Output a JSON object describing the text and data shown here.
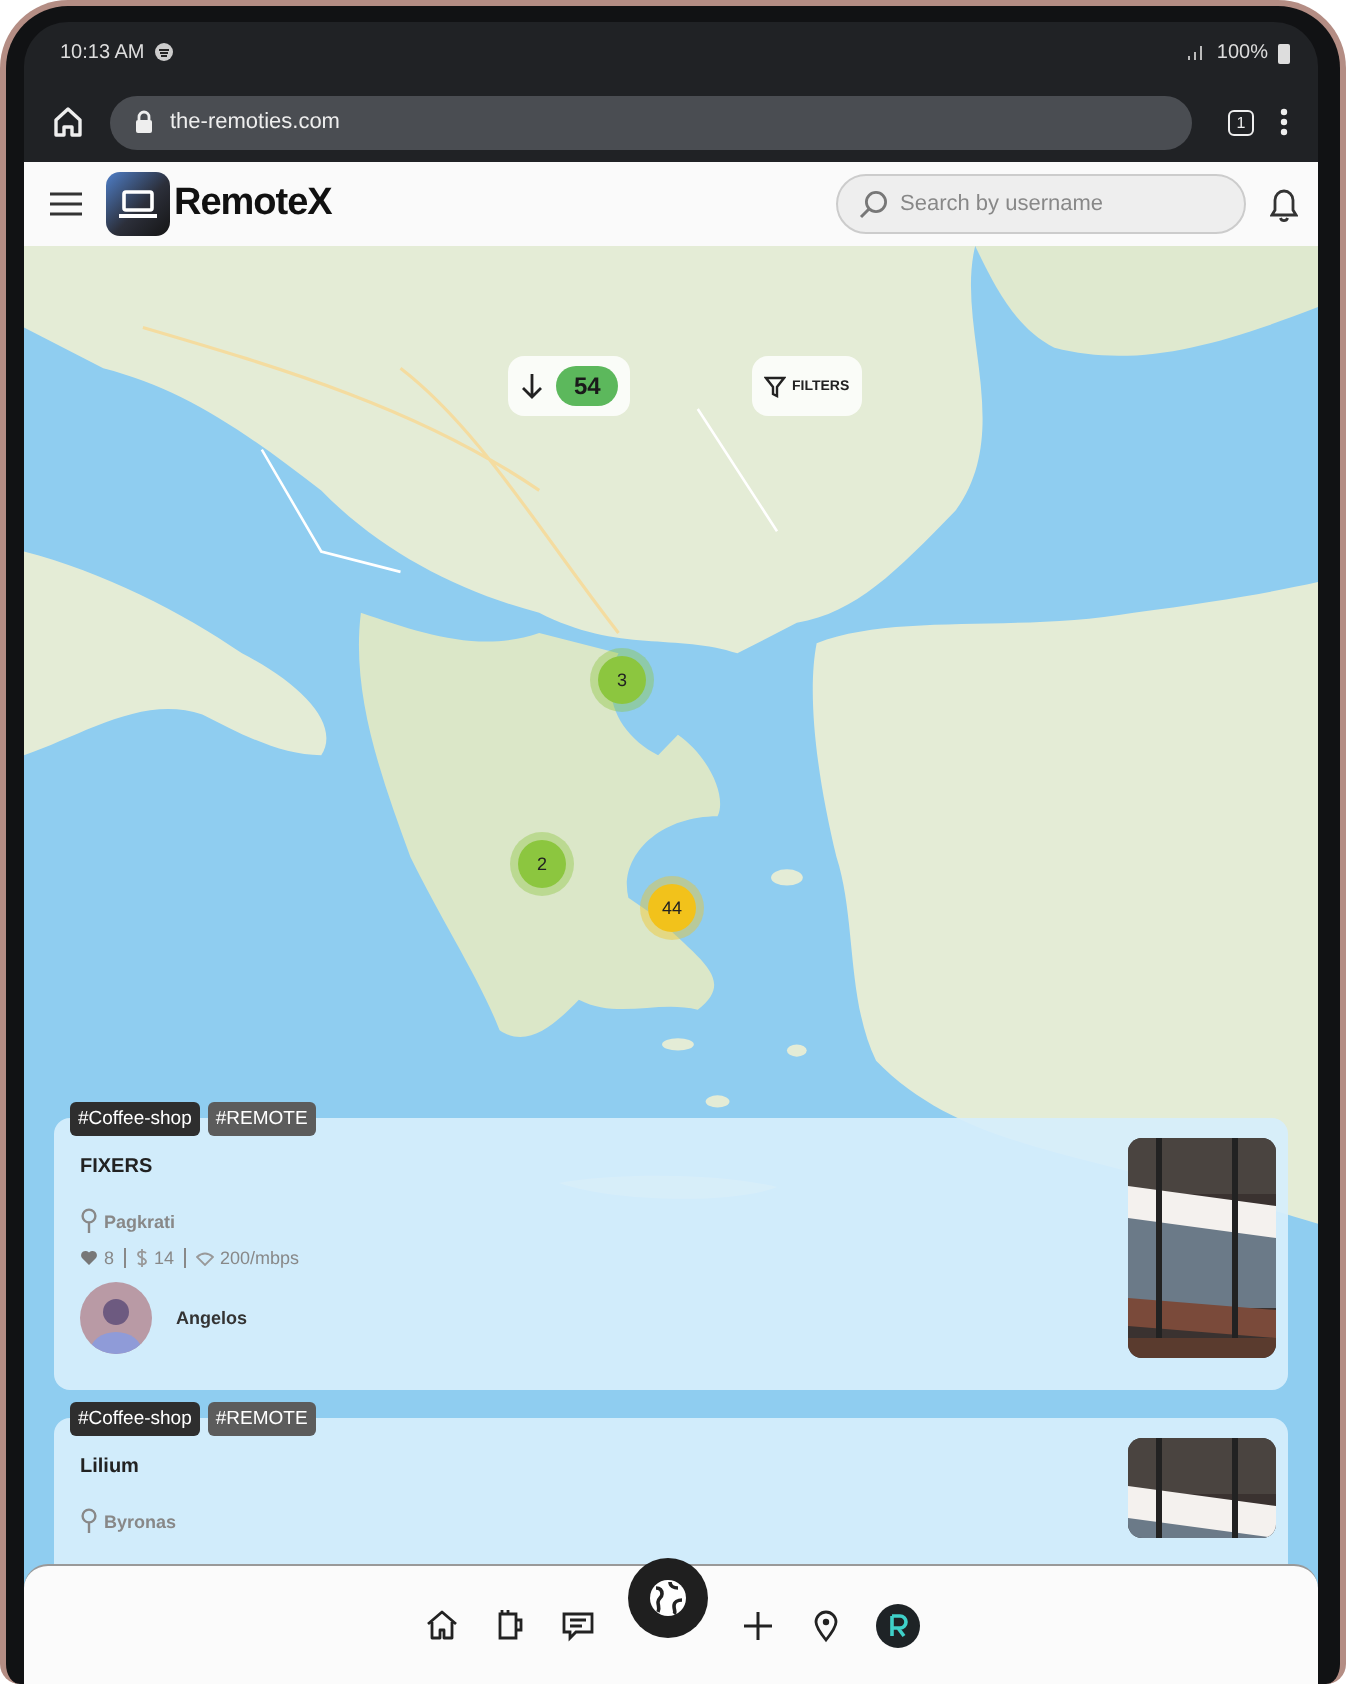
{
  "status_bar": {
    "time": "10:13 AM",
    "battery": "100%"
  },
  "browser": {
    "url": "the-remoties.com",
    "tab_count": "1"
  },
  "header": {
    "logo": "RemoteX",
    "search": {
      "placeholder": "Search by username"
    }
  },
  "map": {
    "kind": "picture",
    "total": {
      "count": "54"
    },
    "filters": {
      "label": "FILTERS"
    },
    "clusters": [
      {
        "count": "3",
        "color": "#8cc63f"
      },
      {
        "count": "2",
        "color": "#8cc63f"
      },
      {
        "count": "44",
        "color": "#f2c21b"
      }
    ]
  },
  "cards": [
    {
      "tags": [
        {
          "label": "#Coffee-shop",
          "color": "#2e2e2e"
        },
        {
          "label": "#REMOTE",
          "color": "#5c5c5c"
        }
      ],
      "name": "FIXERS",
      "location": "Pagkrati",
      "likes": "8",
      "price": "14",
      "speed": "200/mbps",
      "user": "Angelos"
    },
    {
      "tags": [
        {
          "label": "#Coffee-shop",
          "color": "#2e2e2e"
        },
        {
          "label": "#REMOTE",
          "color": "#5c5c5c"
        }
      ],
      "name": "Lilium",
      "location": "Byronas"
    }
  ],
  "nav": [
    {
      "kind": "home"
    },
    {
      "kind": "cup"
    },
    {
      "kind": "chat"
    },
    {
      "kind": "globe"
    },
    {
      "kind": "plus"
    },
    {
      "kind": "pin"
    },
    {
      "kind": "brand"
    }
  ]
}
